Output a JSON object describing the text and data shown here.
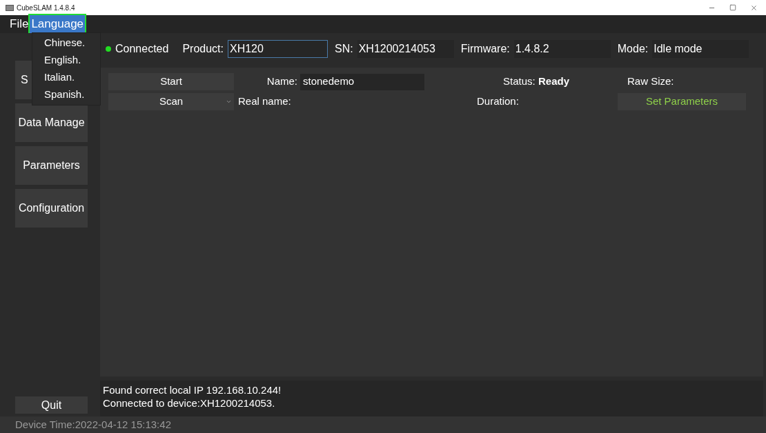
{
  "window": {
    "title": "CubeSLAM 1.4.8.4"
  },
  "menu_bar": [
    {
      "label": "File",
      "selected": false
    },
    {
      "label": "Language",
      "selected": true
    }
  ],
  "language_menu": [
    "Chinese.",
    "English.",
    "Italian.",
    "Spanish."
  ],
  "sidebar": {
    "items": [
      {
        "label": "S"
      },
      {
        "label": "Data Manage"
      },
      {
        "label": "Parameters"
      },
      {
        "label": "Configuration"
      }
    ],
    "quit": "Quit"
  },
  "device_bar": {
    "connection": {
      "label": "Connected",
      "color": "#22dd22"
    },
    "fields": [
      {
        "label": "Product:",
        "value": "XH120",
        "focused": true
      },
      {
        "label": "SN:",
        "value": "XH1200214053",
        "focused": false
      },
      {
        "label": "Firmware:",
        "value": "1.4.8.2",
        "focused": false
      },
      {
        "label": "Mode:",
        "value": "Idle mode",
        "focused": false
      }
    ]
  },
  "controls": {
    "start": "Start",
    "scan": "Scan",
    "name_label": "Name:",
    "name_value": "stonedemo",
    "real_name_label": "Real name:",
    "status_label": "Status:",
    "status_value": "Ready",
    "duration_label": "Duration:",
    "raw_size_label": "Raw Size:",
    "set_parameters": "Set Parameters"
  },
  "log": [
    "Found correct local IP 192.168.10.244!",
    "Connected to device:XH1200214053."
  ],
  "status_bar": "Device Time:2022-04-12 15:13:42"
}
